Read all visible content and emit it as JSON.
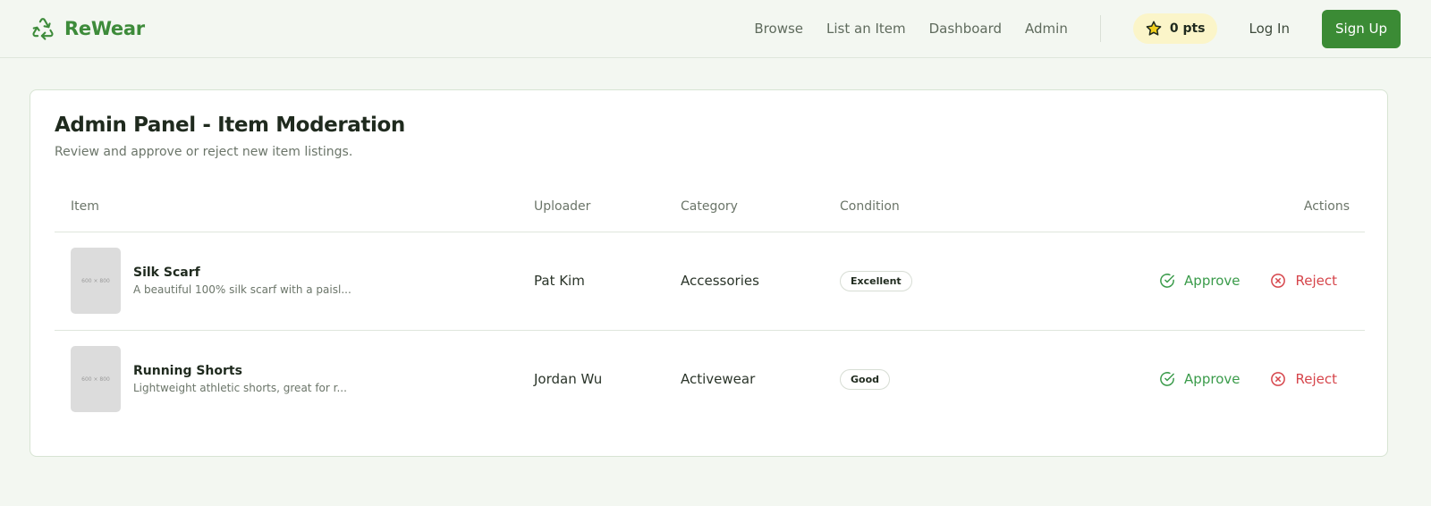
{
  "brand": {
    "name": "ReWear",
    "icon": "recycle-icon",
    "color": "#3d8b3a"
  },
  "nav": {
    "links": [
      "Browse",
      "List an Item",
      "Dashboard",
      "Admin"
    ],
    "points": "0 pts",
    "points_icon": "star-icon",
    "login": "Log In",
    "signup": "Sign Up"
  },
  "page": {
    "title": "Admin Panel - Item Moderation",
    "subtitle": "Review and approve or reject new item listings."
  },
  "table": {
    "headers": {
      "item": "Item",
      "uploader": "Uploader",
      "category": "Category",
      "condition": "Condition",
      "actions": "Actions"
    },
    "rows": [
      {
        "thumb_label": "600 × 800",
        "name": "Silk Scarf",
        "description": "A beautiful 100% silk scarf with a paisl...",
        "uploader": "Pat Kim",
        "category": "Accessories",
        "condition": "Excellent",
        "approve": "Approve",
        "reject": "Reject"
      },
      {
        "thumb_label": "600 × 800",
        "name": "Running Shorts",
        "description": "Lightweight athletic shorts, great for r...",
        "uploader": "Jordan Wu",
        "category": "Activewear",
        "condition": "Good",
        "approve": "Approve",
        "reject": "Reject"
      }
    ]
  },
  "colors": {
    "primary": "#3b8b35",
    "approve": "#3a9b4a",
    "reject": "#d6454b",
    "points_bg": "#fbf5c9"
  }
}
